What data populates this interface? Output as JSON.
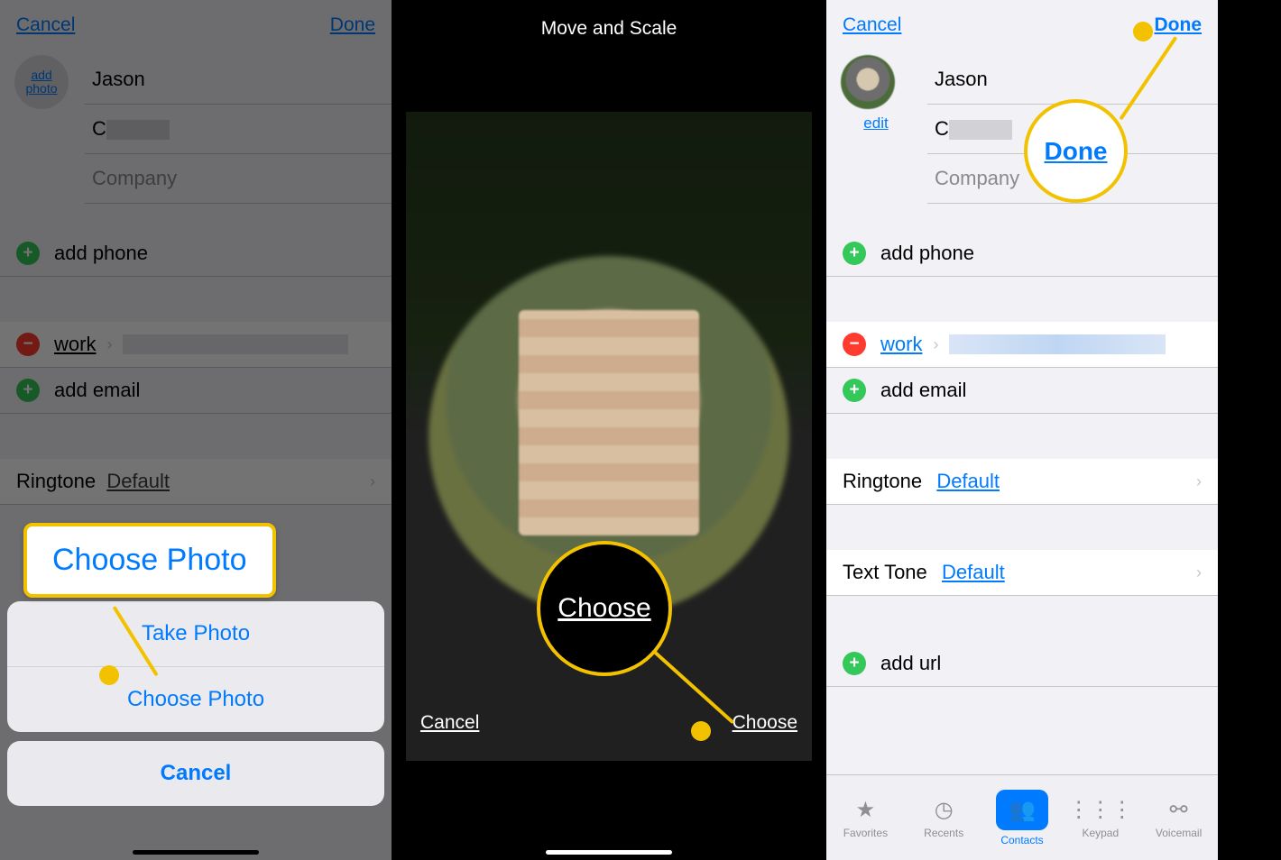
{
  "panel1": {
    "topbar": {
      "cancel": "Cancel",
      "done": "Done"
    },
    "avatar_label": "add\nphoto",
    "name_first": "Jason",
    "name_last_prefix": "C",
    "company_placeholder": "Company",
    "add_phone": "add phone",
    "work_label": "work",
    "add_email": "add email",
    "ringtone_label": "Ringtone",
    "ringtone_value": "Default",
    "sheet": {
      "take_photo": "Take Photo",
      "choose_photo": "Choose Photo",
      "cancel": "Cancel"
    },
    "callout": "Choose Photo"
  },
  "panel2": {
    "title": "Move and Scale",
    "cancel": "Cancel",
    "choose": "Choose",
    "callout": "Choose"
  },
  "panel3": {
    "topbar": {
      "cancel": "Cancel",
      "done": "Done"
    },
    "edit": "edit",
    "name_first": "Jason",
    "name_last_prefix": "C",
    "company_placeholder": "Company",
    "add_phone": "add phone",
    "work_label": "work",
    "add_email": "add email",
    "ringtone_label": "Ringtone",
    "ringtone_value": "Default",
    "texttone_label": "Text Tone",
    "texttone_value": "Default",
    "add_url": "add url",
    "callout": "Done",
    "tabs": {
      "favorites": "Favorites",
      "recents": "Recents",
      "contacts": "Contacts",
      "keypad": "Keypad",
      "voicemail": "Voicemail"
    }
  }
}
